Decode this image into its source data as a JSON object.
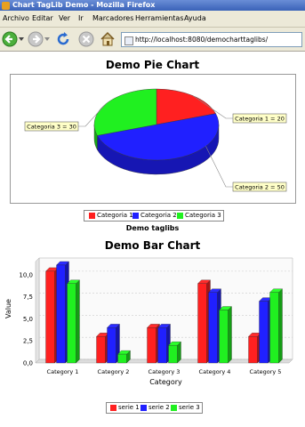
{
  "window": {
    "title": "Chart TagLib Demo - Mozilla Firefox"
  },
  "menu": [
    "Archivo",
    "Editar",
    "Ver",
    "Ir",
    "Marcadores",
    "Herramientas",
    "Ayuda"
  ],
  "address": {
    "url": "http://localhost:8080/democharttaglibs/"
  },
  "icons": {
    "back": "back-arrow-icon",
    "forward": "forward-arrow-icon",
    "reload": "reload-icon",
    "stop": "stop-icon",
    "home": "home-icon",
    "favicon": "page-icon"
  },
  "colors": {
    "red": "#ff2020",
    "blue": "#2020ff",
    "green": "#20f020"
  },
  "pie": {
    "title": "Demo Pie Chart",
    "subtitle": "Demo taglibs",
    "labels": [
      "Categoria 1 = 20",
      "Categoria 2 = 50",
      "Categoria 3 = 30"
    ],
    "legend": [
      "Categoria 1",
      "Categoria 2",
      "Categoria 3"
    ]
  },
  "bar": {
    "title": "Demo Bar Chart",
    "legend": [
      "serie 1",
      "serie 2",
      "serie 3"
    ]
  },
  "chart_data": [
    {
      "type": "pie",
      "title": "Demo Pie Chart",
      "subtitle": "Demo taglibs",
      "categories": [
        "Categoria 1",
        "Categoria 2",
        "Categoria 3"
      ],
      "values": [
        20,
        50,
        30
      ],
      "legend": "bottom"
    },
    {
      "type": "bar",
      "title": "Demo Bar Chart",
      "xlabel": "Category",
      "ylabel": "Value",
      "categories": [
        "Category 1",
        "Category 2",
        "Category 3",
        "Category 4",
        "Category 5"
      ],
      "series": [
        {
          "name": "serie 1",
          "values": [
            10.4,
            3.0,
            4.0,
            9.0,
            3.0
          ]
        },
        {
          "name": "serie 2",
          "values": [
            11.1,
            4.0,
            4.0,
            8.0,
            7.0
          ]
        },
        {
          "name": "serie 3",
          "values": [
            9.0,
            1.0,
            2.0,
            6.0,
            8.0
          ]
        }
      ],
      "ylim": [
        0,
        11.5
      ],
      "yticks": [
        "0,0",
        "2,5",
        "5,0",
        "7,5",
        "10,0"
      ],
      "grid": true,
      "legend": "bottom"
    }
  ]
}
